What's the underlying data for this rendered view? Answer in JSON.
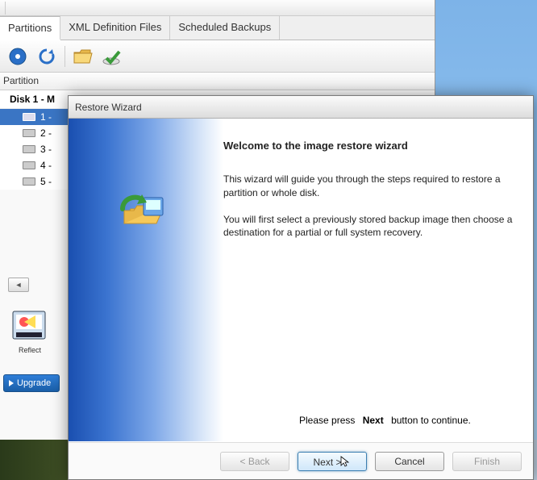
{
  "tabs": {
    "partitions": "Partitions",
    "xml": "XML Definition Files",
    "scheduled": "Scheduled Backups"
  },
  "list": {
    "header": "Partition",
    "disk_label": "Disk 1 - M",
    "rows": [
      "1 -",
      "2 -",
      "3 -",
      "4 -",
      "5 -"
    ]
  },
  "reflect_label": "Reflect",
  "upgrade_label": "Upgrade",
  "dialog": {
    "title": "Restore Wizard",
    "heading": "Welcome to the image restore wizard",
    "para1": "This wizard will guide you through the steps required to restore a partition or whole disk.",
    "para2": "You will first select a previously stored backup image then choose a destination for a partial or full system recovery.",
    "press_prefix": "Please press",
    "press_bold": "Next",
    "press_suffix": "button to continue.",
    "buttons": {
      "back": "< Back",
      "next": "Next >",
      "cancel": "Cancel",
      "finish": "Finish"
    }
  },
  "icons": {
    "disk_blue": "disk-blue",
    "refresh": "refresh",
    "folder": "folder",
    "check": "check-disk"
  }
}
